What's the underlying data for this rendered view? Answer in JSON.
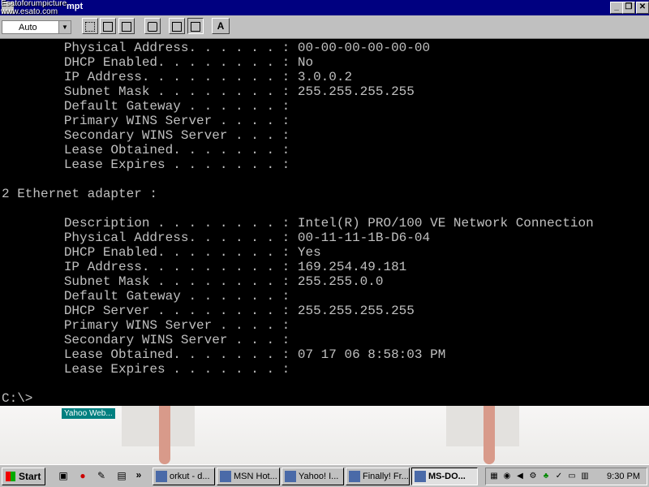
{
  "window": {
    "title": "mpt",
    "watermark_line1": "Esatoforumpicture",
    "watermark_line2": "www.esato.com",
    "min_glyph": "_",
    "max_glyph": "❐",
    "close_glyph": "✕"
  },
  "toolbar": {
    "font_size_value": "Auto",
    "dropdown_glyph": "▼",
    "font_button_label": "A"
  },
  "console": {
    "lines": [
      "        Physical Address. . . . . . : 00-00-00-00-00-00",
      "        DHCP Enabled. . . . . . . . : No",
      "        IP Address. . . . . . . . . : 3.0.0.2",
      "        Subnet Mask . . . . . . . . : 255.255.255.255",
      "        Default Gateway . . . . . . :",
      "        Primary WINS Server . . . . :",
      "        Secondary WINS Server . . . :",
      "        Lease Obtained. . . . . . . :",
      "        Lease Expires . . . . . . . :",
      "",
      "2 Ethernet adapter :",
      "",
      "        Description . . . . . . . . : Intel(R) PRO/100 VE Network Connection",
      "        Physical Address. . . . . . : 00-11-11-1B-D6-04",
      "        DHCP Enabled. . . . . . . . : Yes",
      "        IP Address. . . . . . . . . : 169.254.49.181",
      "        Subnet Mask . . . . . . . . : 255.255.0.0",
      "        Default Gateway . . . . . . :",
      "        DHCP Server . . . . . . . . : 255.255.255.255",
      "        Primary WINS Server . . . . :",
      "        Secondary WINS Server . . . :",
      "        Lease Obtained. . . . . . . : 07 17 06 8:58:03 PM",
      "        Lease Expires . . . . . . . :",
      "",
      "C:\\>"
    ]
  },
  "desktop": {
    "shortcut_label": "Yahoo Web..."
  },
  "taskbar": {
    "start_label": "Start",
    "chevron": "»",
    "tasks": [
      {
        "label": "orkut - d...",
        "active": false
      },
      {
        "label": "MSN Hot...",
        "active": false
      },
      {
        "label": "Yahoo! I...",
        "active": false
      },
      {
        "label": "Finally! Fr...",
        "active": false
      },
      {
        "label": "MS-DO...",
        "active": true
      }
    ],
    "clock": "9:30 PM"
  }
}
